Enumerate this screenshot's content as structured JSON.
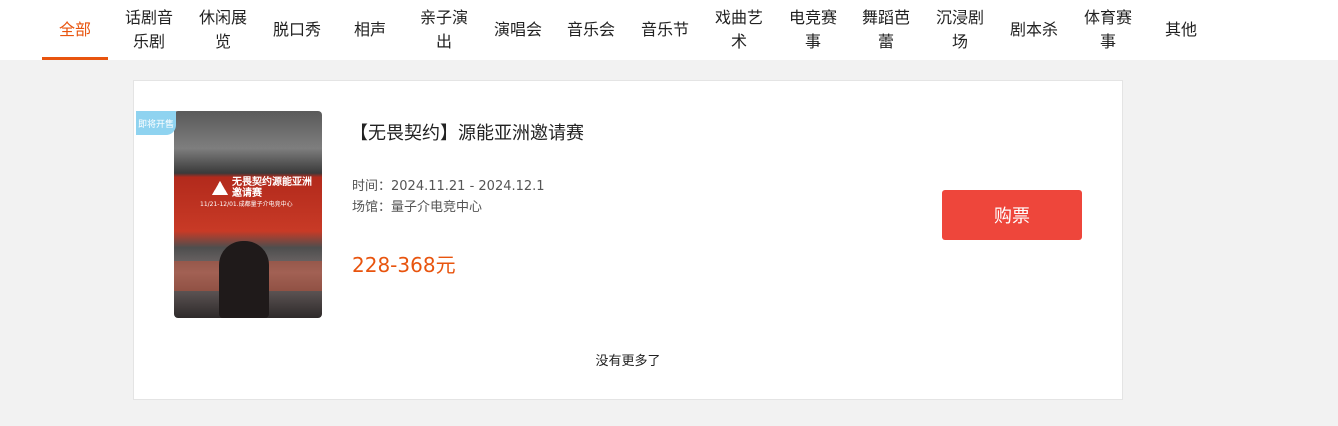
{
  "tabs": [
    {
      "label": "全部",
      "active": true
    },
    {
      "label": "话剧音乐剧"
    },
    {
      "label": "休闲展览"
    },
    {
      "label": "脱口秀"
    },
    {
      "label": "相声"
    },
    {
      "label": "亲子演出"
    },
    {
      "label": "演唱会"
    },
    {
      "label": "音乐会"
    },
    {
      "label": "音乐节"
    },
    {
      "label": "戏曲艺术"
    },
    {
      "label": "电竞赛事"
    },
    {
      "label": "舞蹈芭蕾"
    },
    {
      "label": "沉浸剧场"
    },
    {
      "label": "剧本杀"
    },
    {
      "label": "体育赛事"
    },
    {
      "label": "其他"
    }
  ],
  "event": {
    "badge": "即将开售",
    "poster_title": "无畏契约源能亚洲邀请赛",
    "poster_sub": "11/21-12/01.成都量子介电竞中心",
    "title": "【无畏契约】源能亚洲邀请赛",
    "time_label": "时间：",
    "time_value": "2024.11.21 - 2024.12.1",
    "venue_label": "场馆：",
    "venue_value": "量子介电竞中心",
    "price": "228-368元",
    "buy_label": "购票"
  },
  "footer": {
    "no_more": "没有更多了"
  },
  "colors": {
    "accent": "#e8540e",
    "buy": "#ee463b",
    "badge": "#8fd3f0"
  }
}
